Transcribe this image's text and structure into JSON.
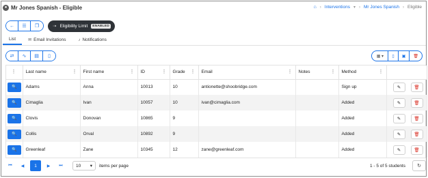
{
  "header": {
    "title": "Mr Jones Spanish - Eligible",
    "breadcrumb": [
      "Interventions",
      "Mr Jones Spanish",
      "Eligible"
    ]
  },
  "toolbar": {
    "eligibility_label": "Eligibility Limit",
    "eligibility_badge": "ENABLED"
  },
  "tabs": [
    {
      "label": "List",
      "active": true
    },
    {
      "label": "Email Invitations",
      "icon": "envelope-icon"
    },
    {
      "label": "Notifications",
      "icon": "bell-icon"
    }
  ],
  "table": {
    "columns": [
      "Last name",
      "First name",
      "ID",
      "Grade",
      "Email",
      "Notes",
      "Method"
    ],
    "rows": [
      {
        "last": "Adams",
        "first": "Anna",
        "id": "10013",
        "grade": "10",
        "email": "antionette@shoobridge.com",
        "notes": "",
        "method": "Sign up"
      },
      {
        "last": "Cimaglia",
        "first": "Ivan",
        "id": "10057",
        "grade": "10",
        "email": "ivan@cimaglia.com",
        "notes": "",
        "method": "Added"
      },
      {
        "last": "Clovis",
        "first": "Donovan",
        "id": "10865",
        "grade": "9",
        "email": "",
        "notes": "",
        "method": "Added"
      },
      {
        "last": "Collis",
        "first": "Orval",
        "id": "10892",
        "grade": "9",
        "email": "",
        "notes": "",
        "method": "Added"
      },
      {
        "last": "Greenleaf",
        "first": "Zane",
        "id": "10345",
        "grade": "12",
        "email": "zane@greenleaf.com",
        "notes": "",
        "method": "Added"
      }
    ]
  },
  "footer": {
    "current_page": "1",
    "page_size": "10",
    "page_size_label": "items per page",
    "count_text": "1 - 5 of 5 students"
  },
  "colors": {
    "accent": "#1a73e8",
    "danger": "#d93025",
    "dark": "#2f3338"
  }
}
